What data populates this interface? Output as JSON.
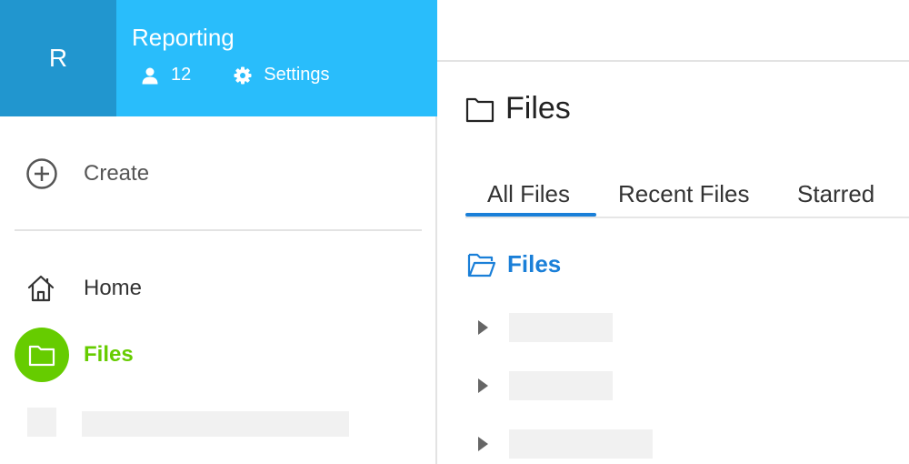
{
  "space": {
    "avatar_letter": "R",
    "name": "Reporting",
    "member_count": "12",
    "settings_label": "Settings",
    "header_color": "#29bdfb",
    "avatar_color": "#2196cf"
  },
  "sidebar": {
    "create_label": "Create",
    "nav": [
      {
        "label": "Home",
        "icon": "home-icon"
      },
      {
        "label": "Files",
        "icon": "folder-icon",
        "active": true,
        "color": "#66cc00"
      }
    ]
  },
  "main": {
    "title": "Files",
    "tabs": [
      {
        "label": "All Files",
        "active": true
      },
      {
        "label": "Recent Files"
      },
      {
        "label": "Starred"
      }
    ],
    "breadcrumb": "Files",
    "accent_color": "#1a7fd8"
  }
}
